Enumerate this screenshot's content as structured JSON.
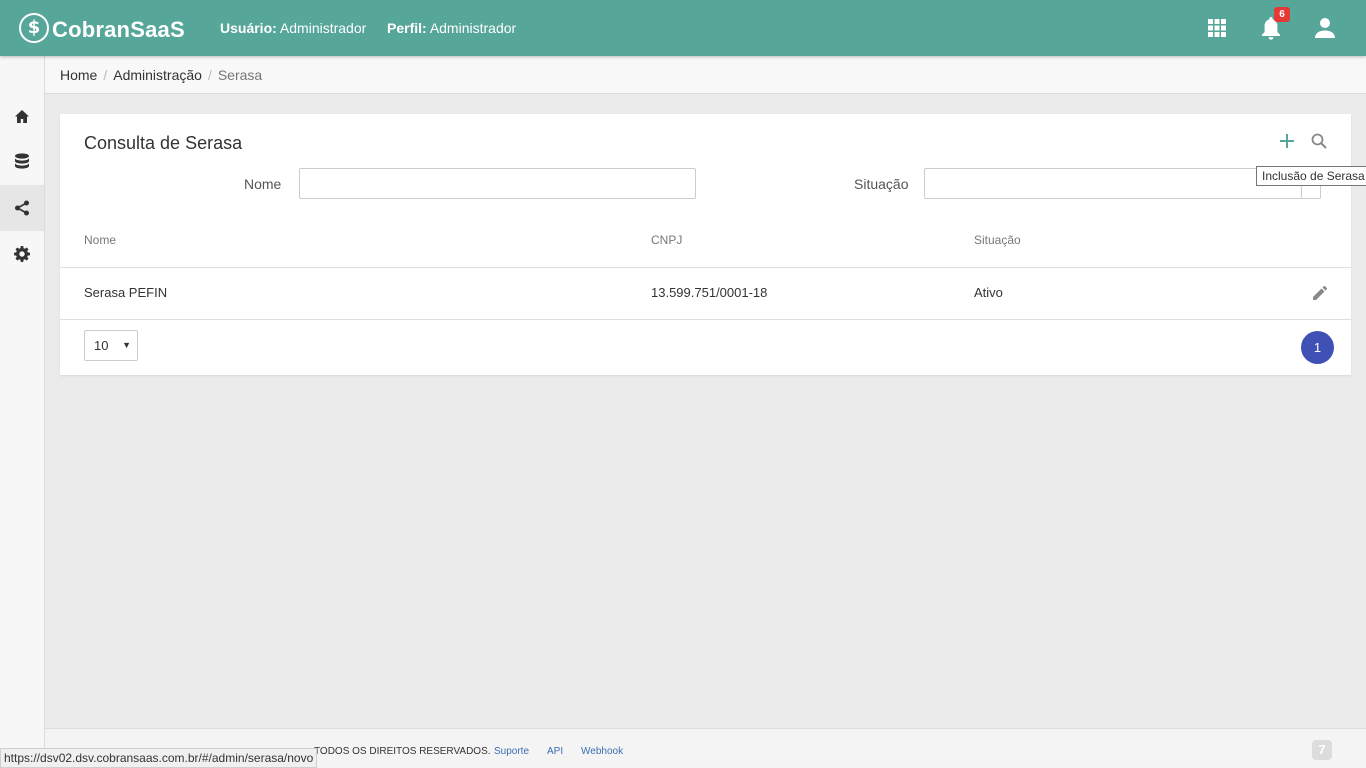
{
  "header": {
    "logo_symbol": "$",
    "logo_text": "CobranSaaS",
    "user_label": "Usuário:",
    "user_value": "Administrador",
    "profile_label": "Perfil:",
    "profile_value": "Administrador",
    "notification_count": "6",
    "brand_color": "#56a69a"
  },
  "sidebar": {
    "items": [
      {
        "icon": "home-icon"
      },
      {
        "icon": "database-icon"
      },
      {
        "icon": "share-icon",
        "active": true
      },
      {
        "icon": "gear-icon"
      }
    ]
  },
  "breadcrumb": {
    "items": [
      "Home",
      "Administração",
      "Serasa"
    ],
    "separator": "/"
  },
  "page": {
    "title": "Consulta de Serasa",
    "add_tooltip": "Inclusão de Serasa",
    "filters": {
      "nome_label": "Nome",
      "nome_value": "",
      "situacao_label": "Situação",
      "situacao_value": ""
    },
    "table": {
      "columns": [
        "Nome",
        "CNPJ",
        "Situação"
      ],
      "rows": [
        {
          "nome": "Serasa PEFIN",
          "cnpj": "13.599.751/0001-18",
          "situacao": "Ativo"
        }
      ]
    },
    "pagination": {
      "page_size": "10",
      "current_page": "1",
      "accent_color": "#3f51b5"
    }
  },
  "footer": {
    "status_url": "https://dsv02.dsv.cobransaas.com.br/#/admin/serasa/novo",
    "rights": "TODOS OS DIREITOS RESERVADOS.",
    "links": [
      "Suporte",
      "API",
      "Webhook"
    ],
    "logo_symbol": "7"
  }
}
